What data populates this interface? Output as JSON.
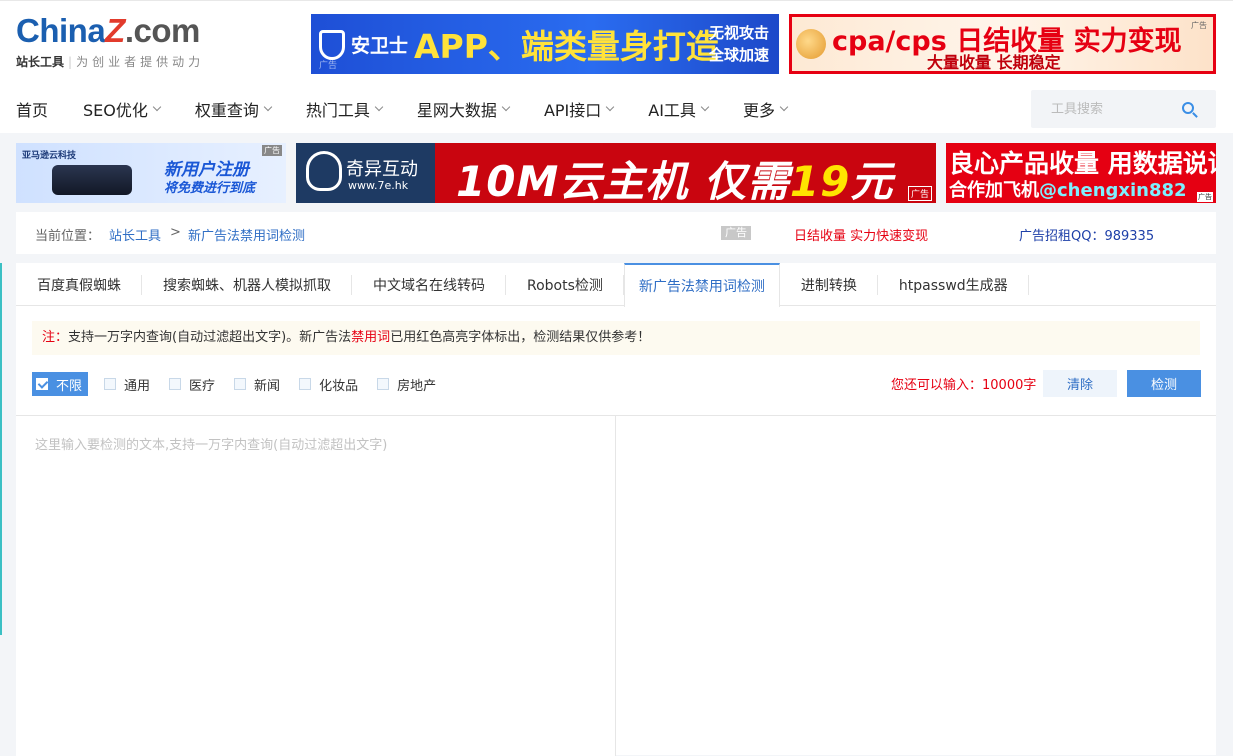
{
  "logo": {
    "brand_part1": "China",
    "brand_z": "Z",
    "brand_part2": ".com",
    "sub_strong": "站长工具",
    "sub_slogan": "为创业者提供动力"
  },
  "ads": {
    "top1": {
      "brand": "安卫士",
      "headline": "APP、端类量身打造",
      "side1": "无视攻击",
      "side2": "全球加速",
      "tag": "广告"
    },
    "top2": {
      "line1": "cpa/cps 日结收量 实力变现",
      "line2": "大量收量 长期稳定",
      "tag": "广告"
    },
    "a": {
      "company": "亚马逊云科技",
      "line1": "新用户注册",
      "line2": "将免费进行到底",
      "tag": "广告"
    },
    "b": {
      "name": "奇异互动",
      "url": "www.7e.hk",
      "headline_yellow": "10M云主机 仅需",
      "headline_num": "19",
      "headline_white": "元",
      "tag": "广告"
    },
    "c": {
      "line1": "良心产品收量 用数据说话",
      "line2_prefix": "合作加飞机",
      "line2_handle": "@chengxin882",
      "tag": "广告"
    }
  },
  "nav": {
    "items": [
      {
        "label": "首页",
        "dropdown": false
      },
      {
        "label": "SEO优化",
        "dropdown": true
      },
      {
        "label": "权重查询",
        "dropdown": true
      },
      {
        "label": "热门工具",
        "dropdown": true
      },
      {
        "label": "星网大数据",
        "dropdown": true
      },
      {
        "label": "API接口",
        "dropdown": true
      },
      {
        "label": "AI工具",
        "dropdown": true
      },
      {
        "label": "更多",
        "dropdown": true
      }
    ],
    "search_placeholder": "工具搜索"
  },
  "breadcrumb": {
    "label": "当前位置：",
    "home": "站长工具",
    "arrow": ">",
    "current": "新广告法禁用词检测",
    "ad_tag": "广告",
    "promo": "日结收量 实力快速变现",
    "qq": "广告招租QQ：989335"
  },
  "tabs": [
    {
      "label": "百度真假蜘蛛",
      "active": false
    },
    {
      "label": "搜索蜘蛛、机器人模拟抓取",
      "active": false
    },
    {
      "label": "中文域名在线转码",
      "active": false
    },
    {
      "label": "Robots检测",
      "active": false
    },
    {
      "label": "新广告法禁用词检测",
      "active": true
    },
    {
      "label": "进制转换",
      "active": false
    },
    {
      "label": "htpasswd生成器",
      "active": false
    }
  ],
  "notice": {
    "prefix": "注：",
    "text1": "支持一万字内查询(自动过滤超出文字)。新广告法",
    "highlight": "禁用词",
    "text2": "已用红色高亮字体标出，检测结果仅供参考！"
  },
  "filters": [
    {
      "label": "不限",
      "checked": true
    },
    {
      "label": "通用",
      "checked": false
    },
    {
      "label": "医疗",
      "checked": false
    },
    {
      "label": "新闻",
      "checked": false
    },
    {
      "label": "化妆品",
      "checked": false
    },
    {
      "label": "房地产",
      "checked": false
    }
  ],
  "remain_text": "您还可以输入：10000字",
  "buttons": {
    "clear": "清除",
    "check": "检测"
  },
  "input": {
    "placeholder": "这里输入要检测的文本,支持一万字内查询(自动过滤超出文字)",
    "value": ""
  },
  "colors": {
    "accent": "#4a90e2",
    "link": "#2f6ec5",
    "warning": "#e60012"
  }
}
